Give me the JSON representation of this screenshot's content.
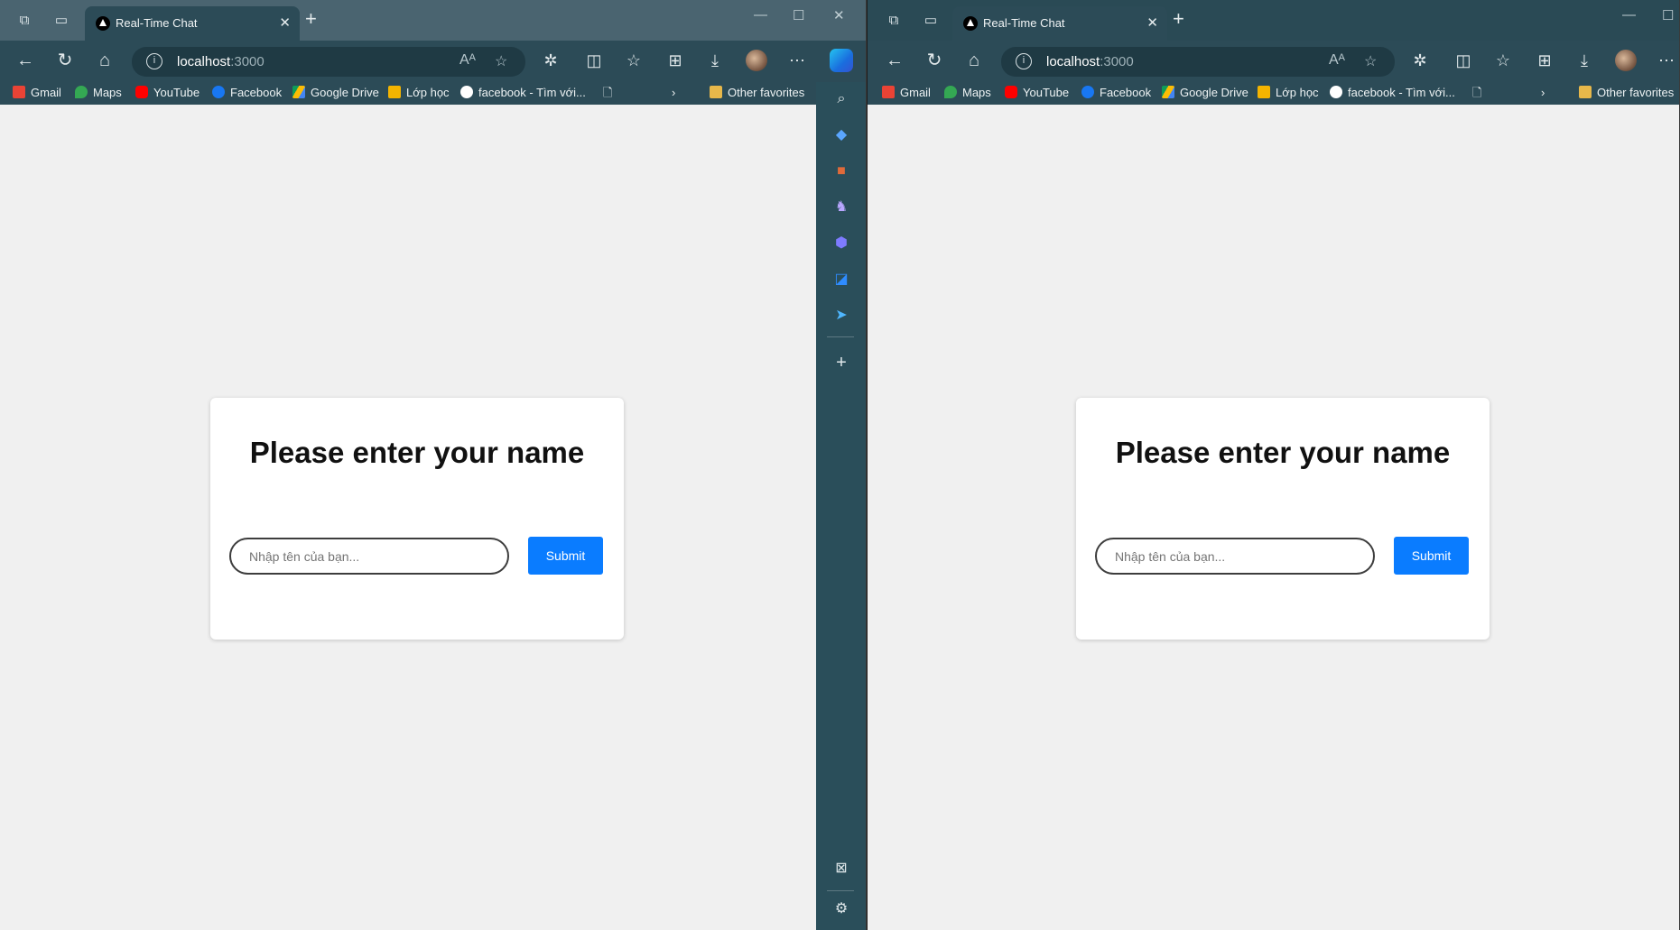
{
  "tab": {
    "title": "Real-Time Chat"
  },
  "address": {
    "host": "localhost",
    "port": ":3000"
  },
  "bookmarks": [
    {
      "label": "Gmail",
      "icon": "gmail-icon",
      "color": "#ea4335"
    },
    {
      "label": "Maps",
      "icon": "maps-icon",
      "color": "#34a853"
    },
    {
      "label": "YouTube",
      "icon": "youtube-icon",
      "color": "#ff0000"
    },
    {
      "label": "Facebook",
      "icon": "facebook-icon",
      "color": "#1877f2"
    },
    {
      "label": "Google Drive",
      "icon": "google-drive-icon",
      "color": "#fbbc04"
    },
    {
      "label": "Lớp học",
      "icon": "classroom-icon",
      "color": "#f4b400"
    },
    {
      "label": "facebook - Tìm với...",
      "icon": "google-icon",
      "color": "#ffffff"
    }
  ],
  "other_favorites": "Other favorites",
  "form": {
    "heading": "Please enter your name",
    "placeholder": "Nhập tên của bạn...",
    "submit_label": "Submit"
  },
  "colors": {
    "submit": "#0a7cff",
    "page_background": "#f0f0f0",
    "toolbar": "#2c4b57"
  }
}
